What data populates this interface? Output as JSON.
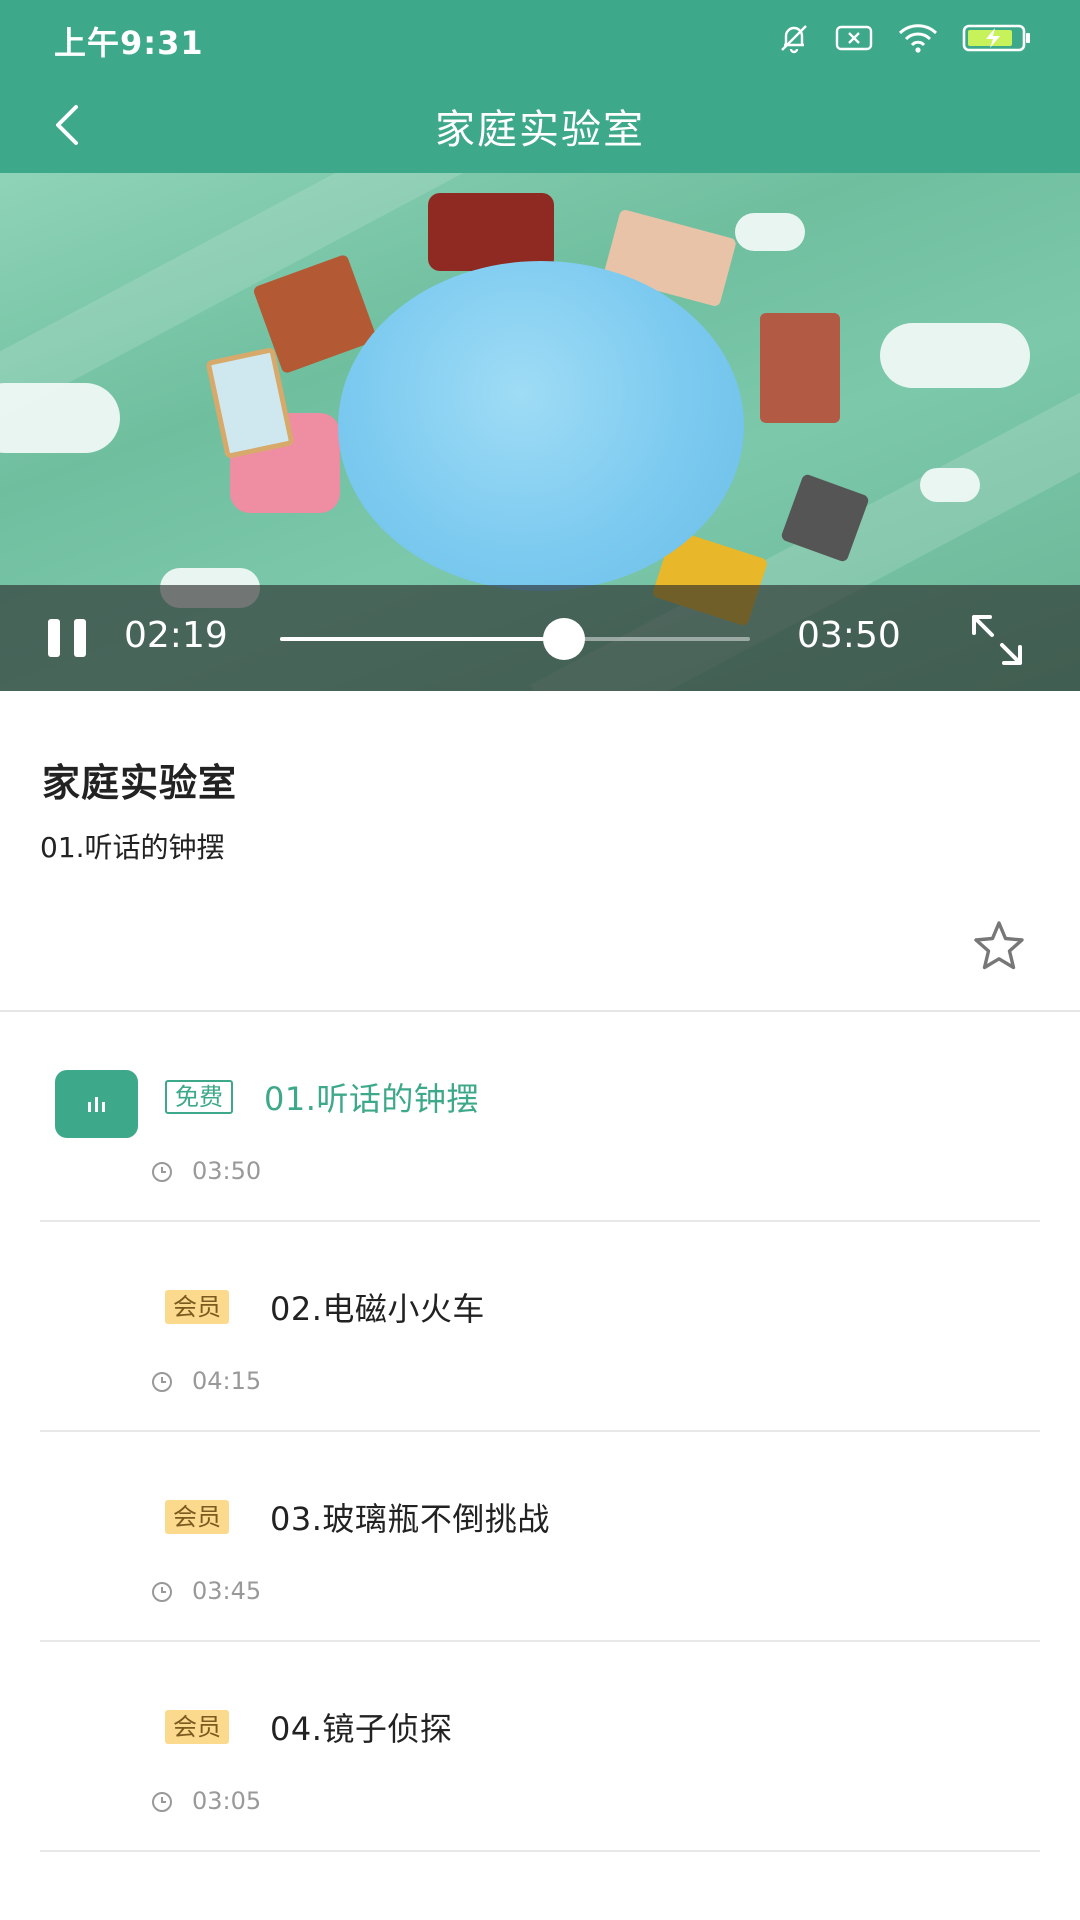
{
  "status_bar": {
    "time": "上午9:31",
    "icons": [
      "mute-bell-icon",
      "sim-x-icon",
      "wifi-icon",
      "battery-charging-icon"
    ]
  },
  "nav": {
    "title": "家庭实验室",
    "back_icon": "chevron-left-icon"
  },
  "player": {
    "current_time": "02:19",
    "total_time": "03:50",
    "progress": 0.605,
    "state": "playing"
  },
  "course": {
    "title": "家庭实验室",
    "current_episode": "01.听话的钟摆",
    "favorite_icon": "star-outline-icon"
  },
  "episodes": [
    {
      "tag": "免费",
      "tag_type": "free",
      "title": "01.听话的钟摆",
      "duration": "03:50",
      "active": true
    },
    {
      "tag": "会员",
      "tag_type": "vip",
      "title": "02.电磁小火车",
      "duration": "04:15",
      "active": false
    },
    {
      "tag": "会员",
      "tag_type": "vip",
      "title": "03.玻璃瓶不倒挑战",
      "duration": "03:45",
      "active": false
    },
    {
      "tag": "会员",
      "tag_type": "vip",
      "title": "04.镜子侦探",
      "duration": "03:05",
      "active": false
    }
  ],
  "colors": {
    "brand": "#3ea88a",
    "vip_tag": "#fbd98d"
  }
}
